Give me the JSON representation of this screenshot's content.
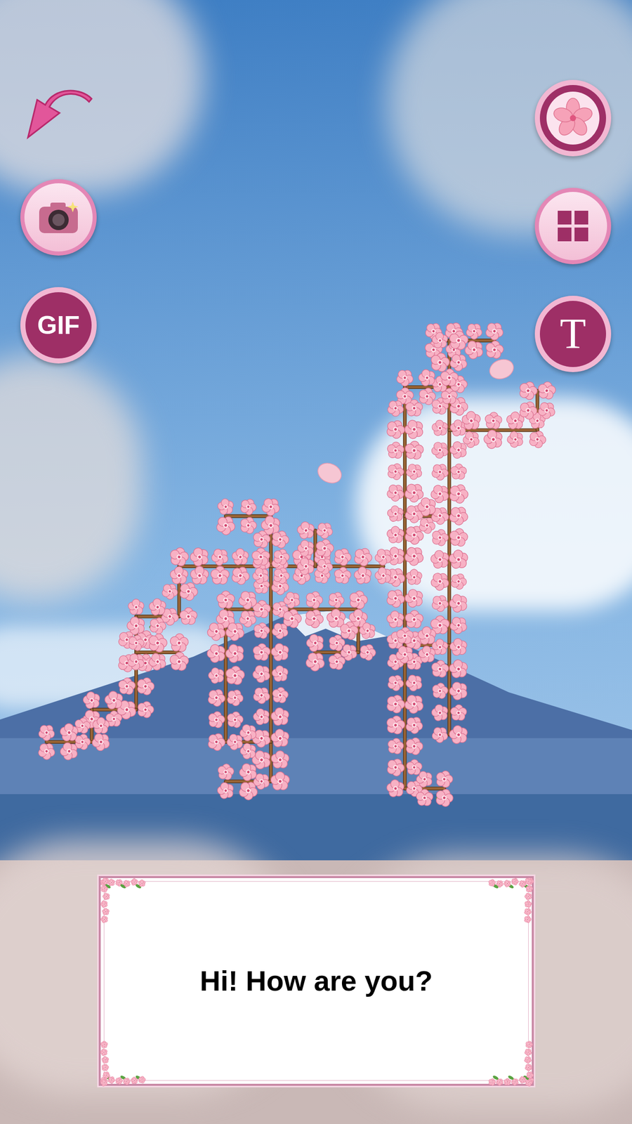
{
  "buttons": {
    "gif": "GIF",
    "text": "T"
  },
  "message": "Hi! How are you?"
}
